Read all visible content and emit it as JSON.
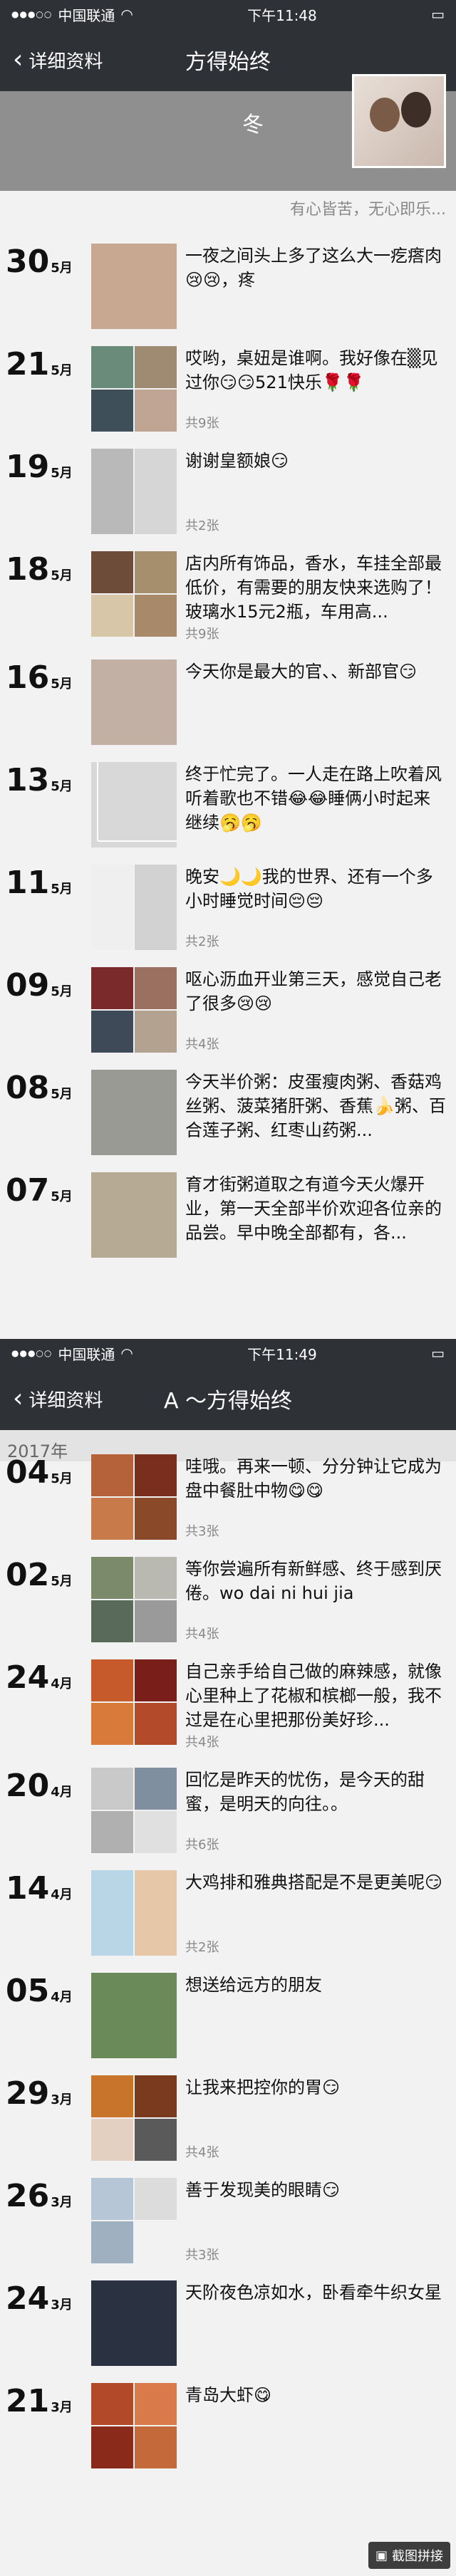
{
  "status_bar": [
    {
      "carrier": "中国联通",
      "time": "下午11:48",
      "battery": "▮"
    },
    {
      "carrier": "中国联通",
      "time": "下午11:49",
      "battery": "▮"
    }
  ],
  "nav": [
    {
      "back": "详细资料",
      "title": "方得始终"
    },
    {
      "back": "详细资料",
      "title": "A ～方得始终"
    }
  ],
  "header": {
    "nick": "冬",
    "signature": "有心皆苦，无心即乐..."
  },
  "year_label": "2017年",
  "posts1": [
    {
      "day": "30",
      "month": "5月",
      "text": "一夜之间头上多了这么大一疙瘩肉😢😢，疼",
      "count": "",
      "colors": [
        "#c8a890"
      ],
      "grid": "g1"
    },
    {
      "day": "21",
      "month": "5月",
      "text": "哎哟，桌妞是谁啊。我好像在▒见过你😏😏521快乐🌹🌹",
      "count": "共9张",
      "colors": [
        "#6a8a7a",
        "#9f8a72",
        "#3f4f5a",
        "#c0a595"
      ],
      "grid": "g4"
    },
    {
      "day": "19",
      "month": "5月",
      "text": "谢谢皇额娘😏",
      "count": "共2张",
      "colors": [
        "#b9b9b9",
        "#d6d6d6"
      ],
      "grid": "g2"
    },
    {
      "day": "18",
      "month": "5月",
      "text": "店内所有饰品，香水，车挂全部最低价，有需要的朋友快来选购了！玻璃水15元2瓶，车用高...",
      "count": "共9张",
      "colors": [
        "#6d4d3a",
        "#a58f6d",
        "#d7c6a8",
        "#a88a6a"
      ],
      "grid": "g4"
    },
    {
      "day": "16",
      "month": "5月",
      "text": "今天你是最大的官、、新部官😏",
      "count": "",
      "colors": [
        "#c3b0a5"
      ],
      "grid": "g1"
    },
    {
      "day": "13",
      "month": "5月",
      "text": "终于忙完了。一人走在路上吹着风听着歌也不错😂😂睡俩小时起来继续🥱🥱",
      "count": "",
      "colors": [
        "#d8d8d8"
      ],
      "grid": "g1",
      "video": true
    },
    {
      "day": "11",
      "month": "5月",
      "text": "晚安🌙🌙我的世界、还有一个多小时睡觉时间😔😔",
      "count": "共2张",
      "colors": [
        "#efefef",
        "#d2d2d2"
      ],
      "grid": "g2"
    },
    {
      "day": "09",
      "month": "5月",
      "text": "呕心沥血开业第三天，感觉自己老了很多😢😢",
      "count": "共4张",
      "colors": [
        "#7a2a2a",
        "#9c7060",
        "#3e4a58",
        "#b3a28f"
      ],
      "grid": "g4"
    },
    {
      "day": "08",
      "month": "5月",
      "text": "今天半价粥：皮蛋瘦肉粥、香菇鸡丝粥、菠菜猪肝粥、香蕉🍌粥、百合莲子粥、红枣山药粥...",
      "count": "",
      "colors": [
        "#9a9a94"
      ],
      "grid": "g1"
    },
    {
      "day": "07",
      "month": "5月",
      "text": "育才街粥道取之有道今天火爆开业，第一天全部半价欢迎各位亲的品尝。早中晚全部都有，各...",
      "count": "",
      "colors": [
        "#b7aa95"
      ],
      "grid": "g1"
    }
  ],
  "posts2": [
    {
      "day": "04",
      "month": "5月",
      "text": "哇哦。再来一顿、分分钟让它成为盘中餐肚中物😋😋",
      "count": "共3张",
      "colors": [
        "#b5623a",
        "#7a2e1e",
        "#c87a4a",
        "#8a4a2a"
      ],
      "grid": "g4"
    },
    {
      "day": "02",
      "month": "5月",
      "text": "等你尝遍所有新鲜感、终于感到厌倦。wo dai ni hui jia",
      "count": "共4张",
      "colors": [
        "#7a8a6a",
        "#b9b9b1",
        "#5a6a5a",
        "#9a9a9a"
      ],
      "grid": "g4"
    },
    {
      "day": "24",
      "month": "4月",
      "text": "自己亲手给自己做的麻辣感，就像心里种上了花椒和槟榔一般，我不过是在心里把那份美好珍...",
      "count": "共4张",
      "colors": [
        "#c75a2a",
        "#7a1e1a",
        "#d87a3a",
        "#b34a2a"
      ],
      "grid": "g4"
    },
    {
      "day": "20",
      "month": "4月",
      "text": "回忆是昨天的忧伤，是今天的甜蜜，是明天的向往。。",
      "count": "共6张",
      "colors": [
        "#c9c9c9",
        "#7f8f9f",
        "#b0b0b0",
        "#e0e0e0"
      ],
      "grid": "g4"
    },
    {
      "day": "14",
      "month": "4月",
      "text": "大鸡排和雅典搭配是不是更美呢😏",
      "count": "共2张",
      "colors": [
        "#b9d6e6",
        "#e6c8a8"
      ],
      "grid": "g2"
    },
    {
      "day": "05",
      "month": "4月",
      "text": "想送给远方的朋友",
      "count": "",
      "colors": [
        "#6a8a5a"
      ],
      "grid": "g1"
    },
    {
      "day": "29",
      "month": "3月",
      "text": "让我来把控你的胃😏",
      "count": "共4张",
      "colors": [
        "#c8742a",
        "#7a3a1e",
        "#e3d0c0",
        "#5a5a5a"
      ],
      "grid": "g4"
    },
    {
      "day": "26",
      "month": "3月",
      "text": "善于发现美的眼睛😏",
      "count": "共3张",
      "colors": [
        "#b6c6d6",
        "#dcdcdc",
        "#9fb0c0"
      ],
      "grid": "g2"
    },
    {
      "day": "24",
      "month": "3月",
      "text": "天阶夜色凉如水，卧看牵牛织女星",
      "count": "",
      "colors": [
        "#2a3140"
      ],
      "grid": "g1"
    },
    {
      "day": "21",
      "month": "3月",
      "text": "青岛大虾😋",
      "count": "",
      "colors": [
        "#b24a2a",
        "#d87a4a",
        "#8a2a1a",
        "#c46a3a"
      ],
      "grid": "g4"
    }
  ],
  "watermark": "截图拼接"
}
